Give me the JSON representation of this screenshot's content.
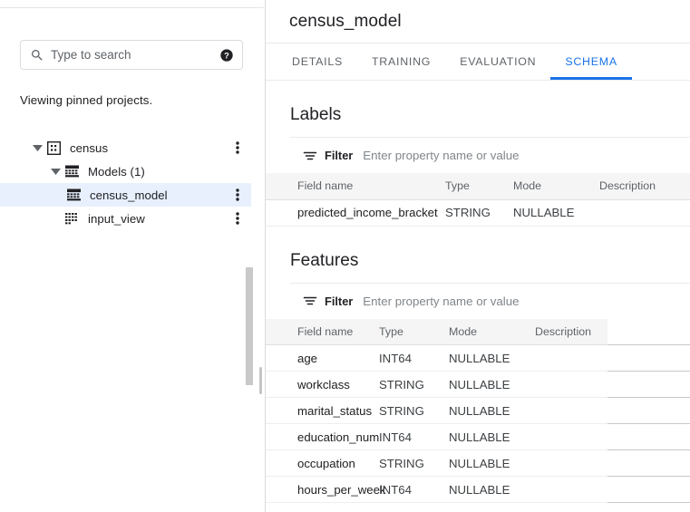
{
  "sidebar": {
    "search": {
      "placeholder": "Type to search",
      "value": "",
      "help_tooltip": "?"
    },
    "viewing_note": "Viewing pinned projects.",
    "tree": [
      {
        "label": "census",
        "icon": "project-icon",
        "indent": 0,
        "expanded": true,
        "has_caret": true,
        "has_menu": true,
        "selected": false
      },
      {
        "label": "Models (1)",
        "icon": "models-icon",
        "indent": 1,
        "expanded": true,
        "has_caret": true,
        "has_menu": false,
        "selected": false
      },
      {
        "label": "census_model",
        "icon": "model-icon",
        "indent": 2,
        "expanded": false,
        "has_caret": false,
        "has_menu": true,
        "selected": true
      },
      {
        "label": "input_view",
        "icon": "view-icon",
        "indent": 1,
        "expanded": false,
        "has_caret": false,
        "has_menu": true,
        "selected": false
      }
    ]
  },
  "main": {
    "title": "census_model",
    "tabs": [
      {
        "label": "DETAILS",
        "active": false
      },
      {
        "label": "TRAINING",
        "active": false
      },
      {
        "label": "EVALUATION",
        "active": false
      },
      {
        "label": "SCHEMA",
        "active": true
      }
    ],
    "accent_color": "#1a73e8",
    "sections": [
      {
        "heading": "Labels",
        "filter": {
          "label": "Filter",
          "placeholder": "Enter property name or value",
          "value": ""
        },
        "columns": [
          "Field name",
          "Type",
          "Mode",
          "Description"
        ],
        "rows": [
          {
            "field_name": "predicted_income_bracket",
            "type": "STRING",
            "mode": "NULLABLE",
            "description": ""
          }
        ]
      },
      {
        "heading": "Features",
        "filter": {
          "label": "Filter",
          "placeholder": "Enter property name or value",
          "value": ""
        },
        "columns": [
          "Field name",
          "Type",
          "Mode",
          "Description"
        ],
        "rows": [
          {
            "field_name": "age",
            "type": "INT64",
            "mode": "NULLABLE",
            "description": ""
          },
          {
            "field_name": "workclass",
            "type": "STRING",
            "mode": "NULLABLE",
            "description": ""
          },
          {
            "field_name": "marital_status",
            "type": "STRING",
            "mode": "NULLABLE",
            "description": ""
          },
          {
            "field_name": "education_num",
            "type": "INT64",
            "mode": "NULLABLE",
            "description": ""
          },
          {
            "field_name": "occupation",
            "type": "STRING",
            "mode": "NULLABLE",
            "description": ""
          },
          {
            "field_name": "hours_per_week",
            "type": "INT64",
            "mode": "NULLABLE",
            "description": ""
          }
        ]
      }
    ]
  }
}
